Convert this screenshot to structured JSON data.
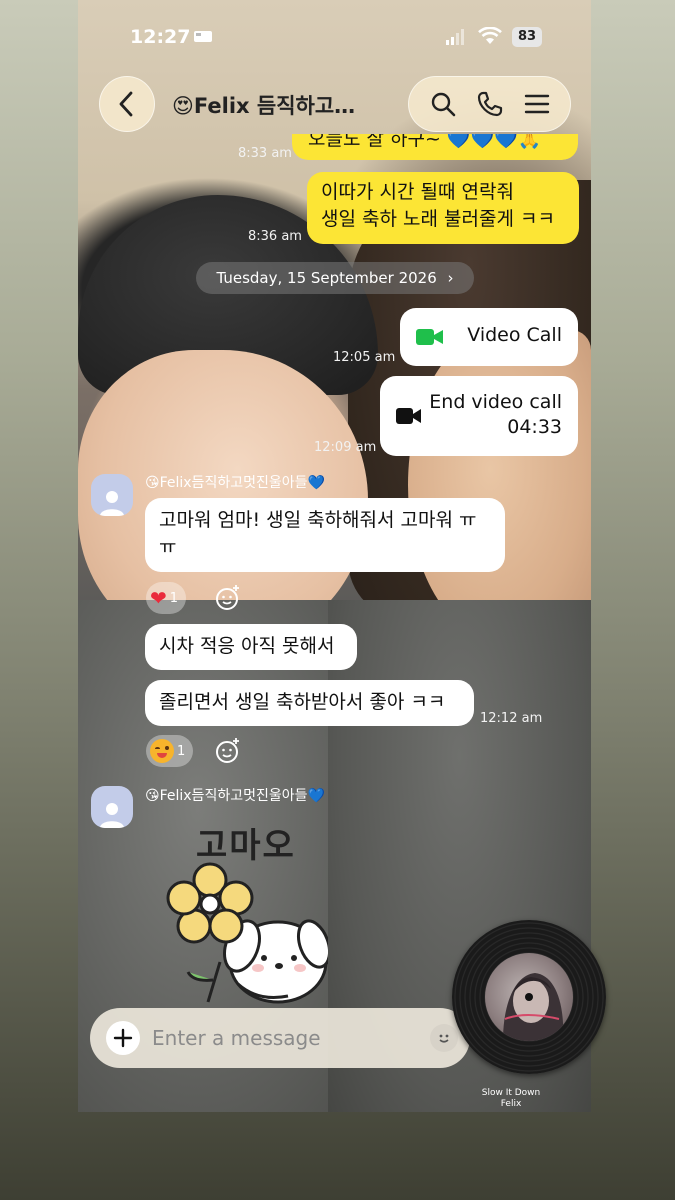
{
  "status_bar": {
    "time": "12:27",
    "battery": "83"
  },
  "header": {
    "title": "😍Felix 듬직하고…"
  },
  "messages": {
    "m1": {
      "text": "오늘도 잘 하구~ 💙💙💙🙏",
      "time": "8:33 am"
    },
    "m2": {
      "line1": "이따가 시간 될때 연락줘",
      "line2": "생일 축하 노래 불러줄게 ㅋㅋ",
      "time": "8:36 am"
    },
    "date_divider": "Tuesday, 15 September 2026",
    "call1": {
      "label": "Video Call",
      "time": "12:05 am"
    },
    "call2": {
      "label": "End video call",
      "duration": "04:33",
      "time": "12:09 am"
    },
    "sender_name": "😘Felix듬직하고멋진울아들💙",
    "r1": {
      "line1": "고마워 엄마! 생일 축하해줘서 고마워 ㅠ",
      "line2": "ㅠ",
      "reaction_count": "1"
    },
    "r2": {
      "text": "시차 적응 아직 못해서"
    },
    "r3": {
      "text": "졸리면서 생일 축하받아서 좋아 ㅋㅋ",
      "time": "12:12 am",
      "reaction_count": "1"
    },
    "sender_name_2": "😘Felix듬직하고멋진울아들💙",
    "sticker_text": "고마오"
  },
  "input": {
    "placeholder": "Enter a message"
  },
  "music": {
    "title": "Slow It Down",
    "artist": "Felix"
  },
  "colors": {
    "yellow_bubble": "#fce535",
    "call_green": "#1fbf4b"
  }
}
